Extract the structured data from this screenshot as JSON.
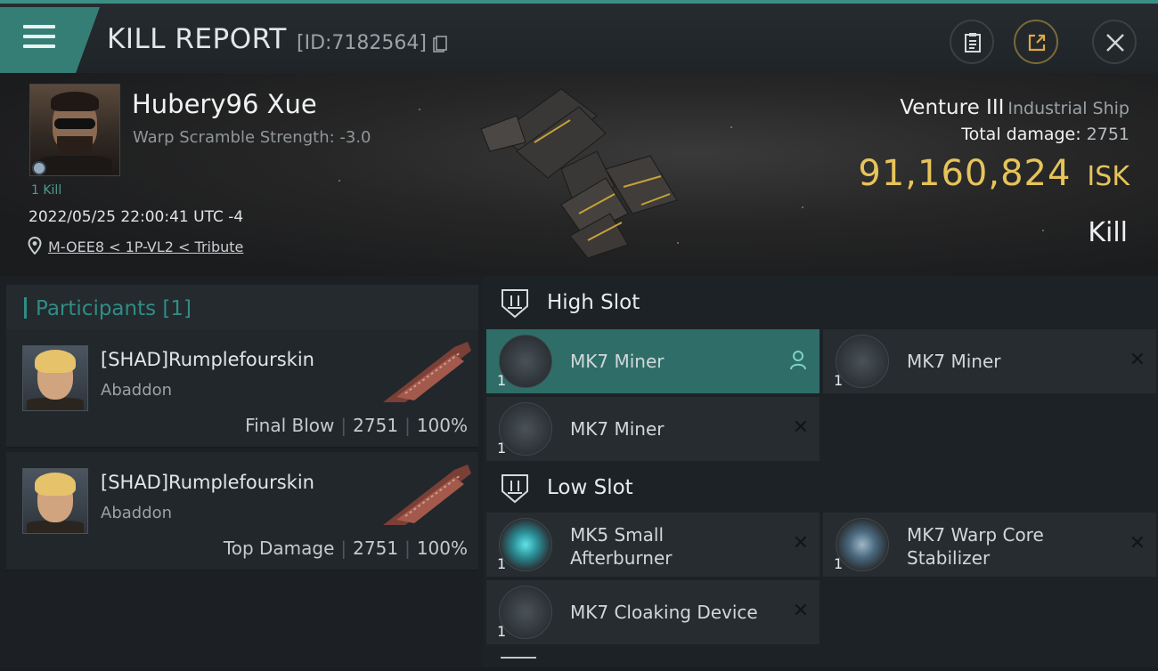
{
  "header": {
    "title": "KILL REPORT",
    "report_id": "[ID:7182564]"
  },
  "victim": {
    "name": "Hubery96 Xue",
    "warp_scramble": "Warp Scramble Strength: -3.0",
    "kills": "1 Kill",
    "datetime": "2022/05/25 22:00:41 UTC -4",
    "location": "M-OEE8 < 1P-VL2 < Tribute"
  },
  "ship": {
    "name": "Venture III",
    "class": "Industrial Ship",
    "total_damage_label": "Total damage:",
    "total_damage": "2751",
    "isk_value": "91,160,824",
    "isk_unit": "ISK",
    "result": "Kill"
  },
  "participants": {
    "header": "Participants [1]",
    "rows": [
      {
        "name": "[SHAD]Rumplefourskin",
        "ship": "Abaddon",
        "role": "Final Blow",
        "damage": "2751",
        "percent": "100%"
      },
      {
        "name": "[SHAD]Rumplefourskin",
        "ship": "Abaddon",
        "role": "Top Damage",
        "damage": "2751",
        "percent": "100%"
      }
    ]
  },
  "slots": {
    "high_label": "High Slot",
    "low_label": "Low Slot",
    "high": [
      {
        "name": "MK7 Miner",
        "qty": "1"
      },
      {
        "name": "MK7 Miner",
        "qty": "1"
      },
      {
        "name": "MK7 Miner",
        "qty": "1"
      }
    ],
    "low": [
      {
        "name": "MK5 Small Afterburner",
        "qty": "1"
      },
      {
        "name": "MK7 Warp Core Stabilizer",
        "qty": "1"
      },
      {
        "name": "MK7 Cloaking Device",
        "qty": "1"
      }
    ]
  },
  "colors": {
    "accent": "#357e76",
    "isk": "#e6c45a"
  }
}
